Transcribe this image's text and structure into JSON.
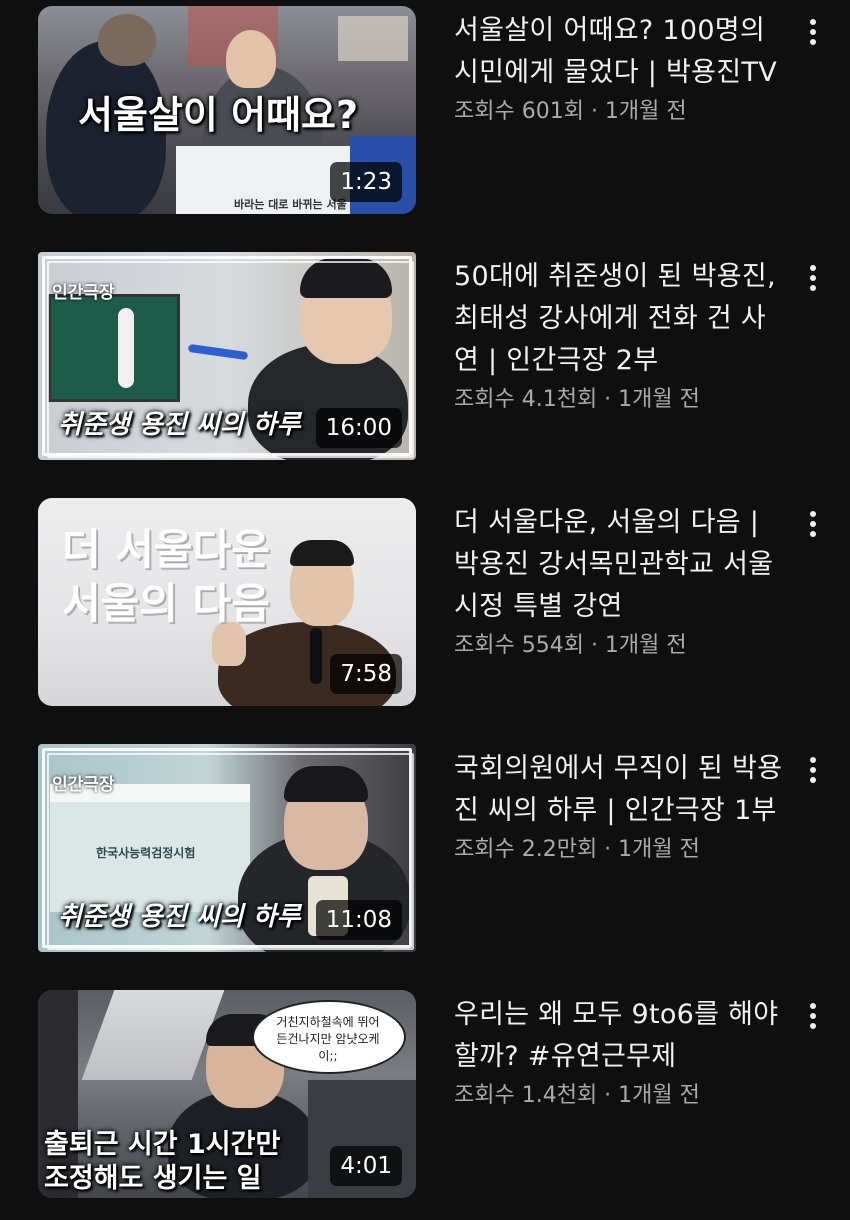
{
  "videos": [
    {
      "title": "서울살이 어때요? 100명의 시민에게 물었다 | 박용진TV",
      "meta": "조회수 601회 · 1개월 전",
      "duration": "1:23",
      "thumb_caption": "서울살이 어때요?",
      "thumb_sub": "바라는 대로 바뀌는 서울"
    },
    {
      "title": "50대에 취준생이 된 박용진, 최태성 강사에게 전화 건 사연 | 인간극장 2부",
      "meta": "조회수 4.1천회 · 1개월 전",
      "duration": "16:00",
      "thumb_tag": "인간극장",
      "thumb_caption": "취준생 용진 씨의 하루"
    },
    {
      "title": "더 서울다운, 서울의 다음 | 박용진 강서목민관학교 서울시정 특별 강연",
      "meta": "조회수 554회 · 1개월 전",
      "duration": "7:58",
      "thumb_caption_line1": "더 서울다운",
      "thumb_caption_line2": "서울의 다음"
    },
    {
      "title": "국회의원에서 무직이 된 박용진 씨의 하루 | 인간극장 1부",
      "meta": "조회수 2.2만회 · 1개월 전",
      "duration": "11:08",
      "thumb_tag": "인간극장",
      "thumb_caption": "취준생 용진 씨의 하루",
      "thumb_screen": "한국사능력검정시험"
    },
    {
      "title": "우리는 왜 모두 9to6를 해야할까? #유연근무제",
      "meta": "조회수 1.4천회 · 1개월 전",
      "duration": "4:01",
      "thumb_bubble": "거친지하철속에 뛰어든건나지만 암냣오케이;;",
      "thumb_caption_line1": "출퇴근 시간 1시간만",
      "thumb_caption_line2": "조정해도 생기는 일"
    }
  ],
  "icons": {
    "more": "more-vertical-icon"
  },
  "colors": {
    "background": "#0f0f0f",
    "title": "#f1f1f1",
    "meta": "#aaaaaa"
  }
}
